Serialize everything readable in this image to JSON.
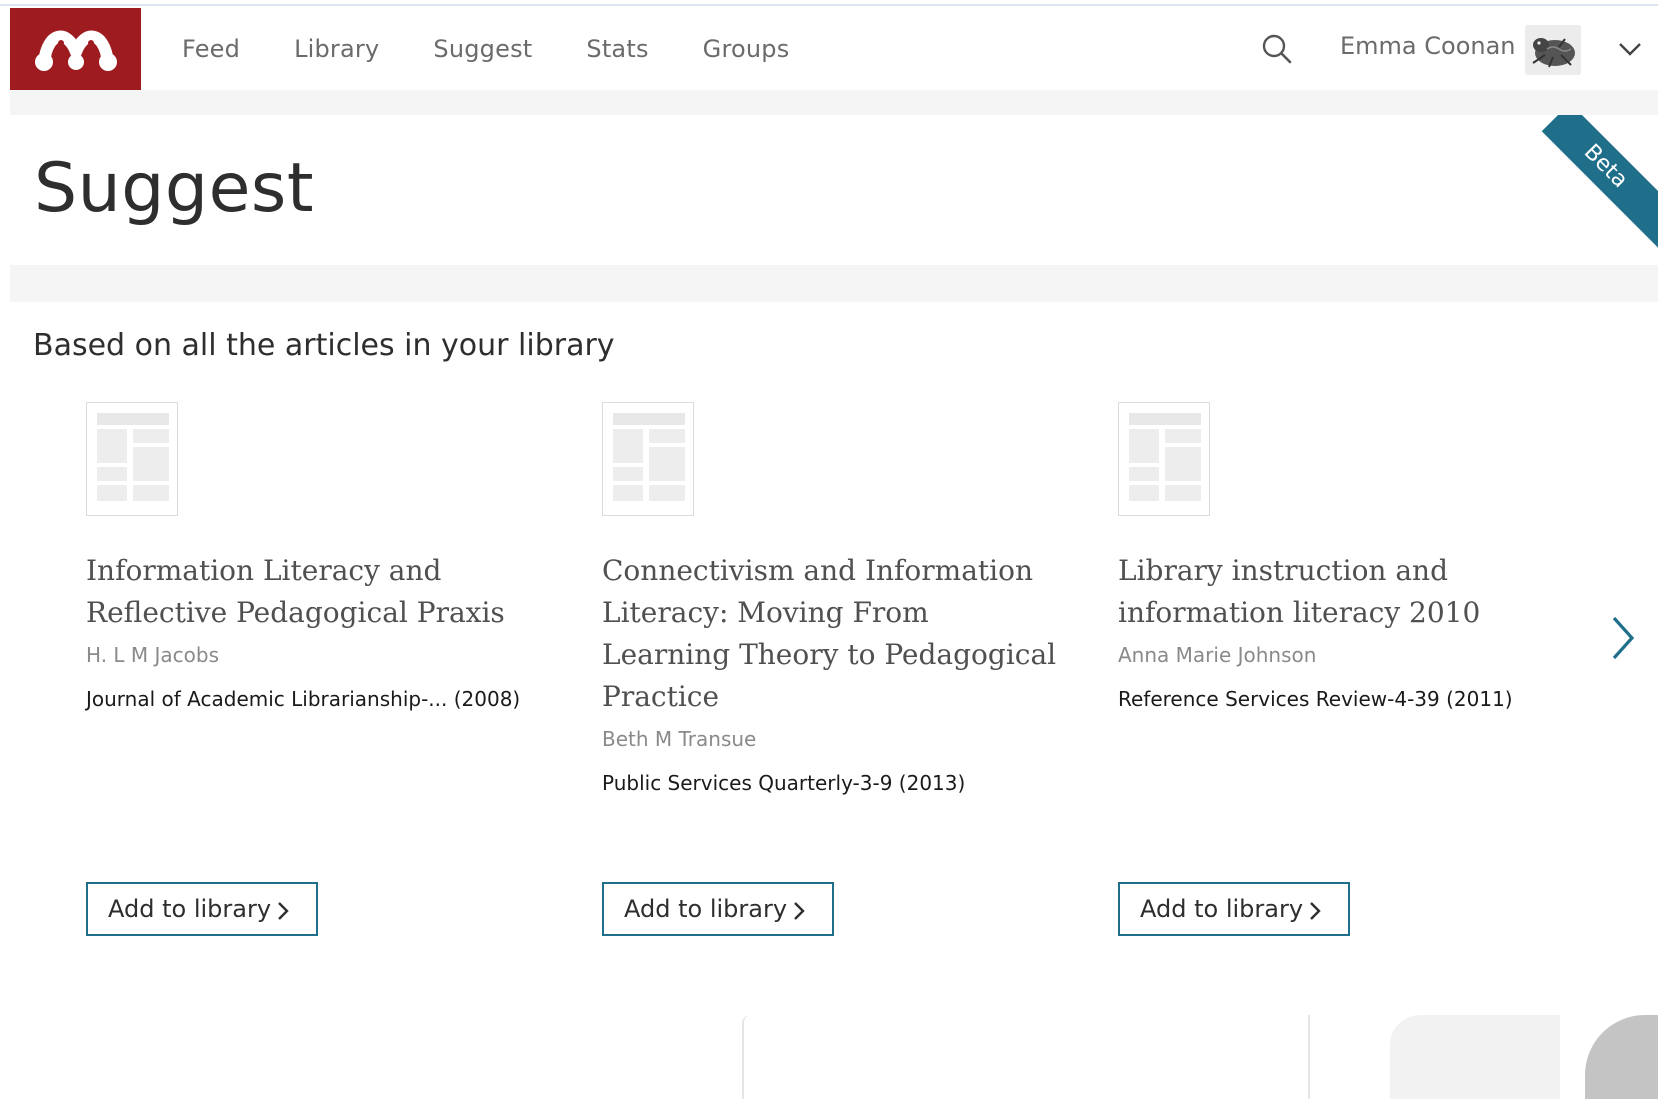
{
  "header": {
    "nav": [
      "Feed",
      "Library",
      "Suggest",
      "Stats",
      "Groups"
    ],
    "user_name": "Emma Coonan"
  },
  "page": {
    "title": "Suggest",
    "beta_label": "Beta",
    "section_heading": "Based on all the articles in your library"
  },
  "cards": [
    {
      "title": "Information Literacy and Reflective Pedagogical Praxis",
      "author": "H. L M Jacobs",
      "journal": "Journal of Academic Librarianship-...  (2008)",
      "button": "Add to library"
    },
    {
      "title": "Connectivism and Information Literacy: Moving From Learning Theory to Pedagogical Practice",
      "author": "Beth M Transue",
      "journal": "Public Services Quarterly-3-9 (2013)",
      "button": "Add to library"
    },
    {
      "title": "Library instruction and information literacy 2010",
      "author": "Anna Marie Johnson",
      "journal": "Reference Services Review-4-39 (2011)",
      "button": "Add to library"
    }
  ],
  "colors": {
    "brand": "#9e1b20",
    "accent": "#1f6f8b"
  },
  "icons": {
    "logo": "mendeley-logo",
    "search": "search-icon",
    "dropdown": "chevron-down-icon",
    "next": "chevron-right-icon"
  }
}
